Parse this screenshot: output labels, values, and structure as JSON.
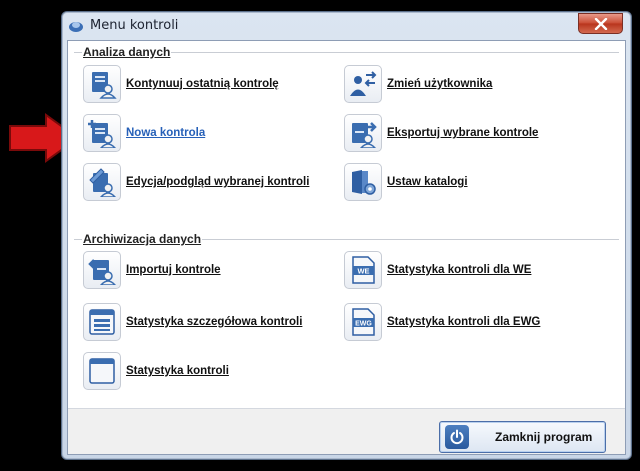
{
  "window": {
    "title": "Menu kontroli"
  },
  "groups": {
    "analysis": {
      "title": "Analiza danych",
      "items": {
        "continue": "Kontynuuj ostatnią kontrolę",
        "change_user": "Zmień użytkownika",
        "new_control": "Nowa kontrola",
        "export": "Eksportuj wybrane kontrole",
        "edit_preview": "Edycja/podgląd wybranej kontroli",
        "set_catalogs": "Ustaw katalogi"
      }
    },
    "archive": {
      "title": "Archiwizacja danych",
      "items": {
        "import": "Importuj kontrole",
        "stats_we": "Statystyka kontroli dla WE",
        "stats_detailed": "Statystyka szczegółowa kontroli",
        "stats_ewg": "Statystyka kontroli dla EWG",
        "stats": "Statystyka kontroli"
      },
      "icon_text": {
        "we": "WE",
        "ewg": "EWG"
      }
    }
  },
  "footer": {
    "close_program": "Zamknij program"
  },
  "colors": {
    "accent": "#2660b8",
    "arrow": "#d8181a",
    "icon_blue": "#2f5fa3"
  }
}
